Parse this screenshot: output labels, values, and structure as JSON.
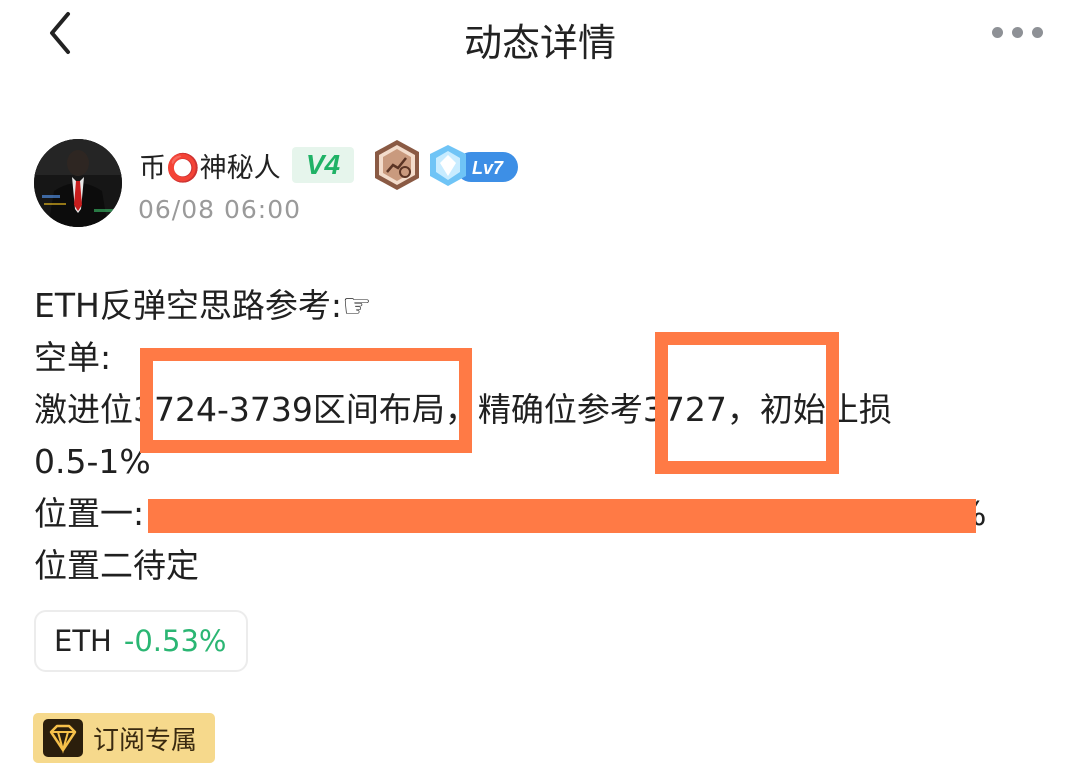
{
  "header": {
    "title": "动态详情"
  },
  "author": {
    "name": "币⭕神秘人",
    "vip_badge": "V4",
    "level_badge": "Lv7",
    "time": "06/08 06:00"
  },
  "post": {
    "lines": [
      "ETH反弹空思路参考:☞",
      "空单:",
      "激进位3724-3739区间布局，精确位参考3727，初始止损",
      "0.5-1%",
      "位置一:",
      "位置二待定"
    ],
    "line5_tail": "1%"
  },
  "ticker": {
    "symbol": "ETH",
    "change": "-0.53%"
  },
  "subscription_tag": {
    "label": "订阅专属"
  },
  "colors": {
    "annotation": "#ff7a45",
    "positive_green": "#2bb673",
    "vip_green": "#1fb266",
    "tag_gold": "#f6d98c"
  }
}
